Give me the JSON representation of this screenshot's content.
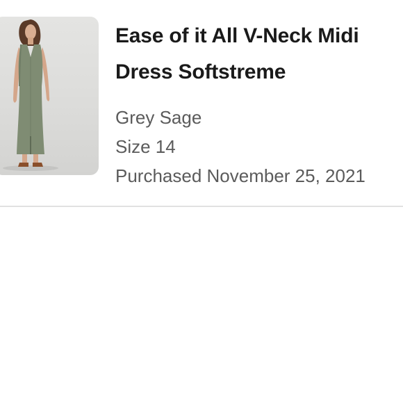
{
  "order_item": {
    "title": "Ease of it All V-Neck Midi Dress Softstreme",
    "color": "Grey Sage",
    "size": "Size 14",
    "purchased": "Purchased November 25, 2021"
  }
}
